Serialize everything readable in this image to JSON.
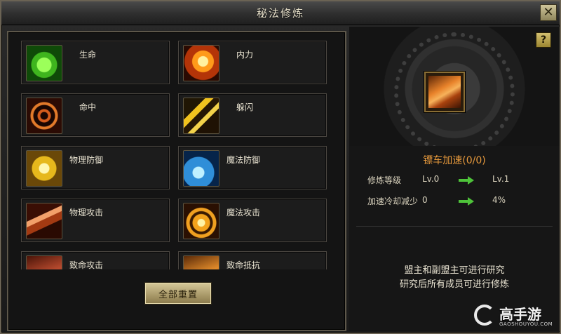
{
  "window": {
    "title": "秘法修炼",
    "close_glyph": "✕"
  },
  "skills": [
    {
      "label": "生命",
      "icon": "life-icon"
    },
    {
      "label": "内力",
      "icon": "inner-power-icon"
    },
    {
      "label": "命中",
      "icon": "accuracy-icon"
    },
    {
      "label": "躲闪",
      "icon": "dodge-icon"
    },
    {
      "label": "物理防御",
      "icon": "physical-defense-icon"
    },
    {
      "label": "魔法防御",
      "icon": "magic-defense-icon"
    },
    {
      "label": "物理攻击",
      "icon": "physical-attack-icon"
    },
    {
      "label": "魔法攻击",
      "icon": "magic-attack-icon"
    },
    {
      "label": "致命攻击",
      "icon": "critical-attack-icon"
    },
    {
      "label": "致命抵抗",
      "icon": "critical-resist-icon"
    }
  ],
  "reset_button": {
    "label": "全部重置"
  },
  "detail": {
    "help_glyph": "?",
    "icon": "escort-speed-icon",
    "name": "镖车加速(0/0)",
    "stats": [
      {
        "label": "修炼等级",
        "from": "Lv.0",
        "to": "Lv.1"
      },
      {
        "label": "加速冷却减少",
        "from": "0",
        "to": "4%"
      }
    ],
    "notes": [
      "盟主和副盟主可进行研究",
      "研究后所有成员可进行修炼"
    ]
  },
  "watermark": {
    "brand": "高手游",
    "domain": "GAOSHOUYOU.COM"
  },
  "colors": {
    "accent_orange": "#e89a3c",
    "arrow_green": "#4ec33a",
    "frame_gold": "#8a6e34"
  }
}
